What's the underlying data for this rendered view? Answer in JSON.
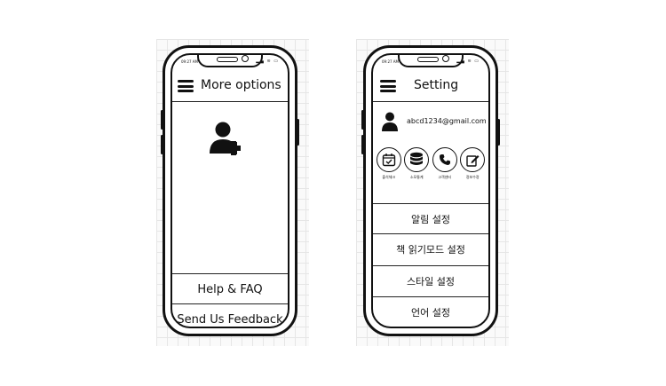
{
  "screen_left": {
    "status": {
      "time": "09:27 AM",
      "icons": "▂▄ ≋ ▭"
    },
    "header": {
      "title": "More options"
    },
    "add_user_icon": "add-user-icon",
    "items": [
      {
        "label": "Help & FAQ"
      },
      {
        "label": "Send Us Feedback"
      }
    ]
  },
  "screen_right": {
    "status": {
      "time": "09:27 AM",
      "icons": "▂▄ ≋ ▭"
    },
    "header": {
      "title": "Setting"
    },
    "profile": {
      "email": "abcd1234@gmail.com"
    },
    "shortcuts": [
      {
        "icon": "calendar-check-icon",
        "label": "출석체크"
      },
      {
        "icon": "database-icon",
        "label": "소모통계"
      },
      {
        "icon": "phone-icon",
        "label": "고객센터"
      },
      {
        "icon": "edit-icon",
        "label": "정보수정"
      }
    ],
    "menu": [
      {
        "label": "알림 설정"
      },
      {
        "label": "책 읽기모드 설정"
      },
      {
        "label": "스타일 설정"
      },
      {
        "label": "언어 설정"
      }
    ]
  },
  "colors": {
    "ink": "#111111",
    "grid": "#e6e6e6",
    "background": "#ffffff"
  }
}
